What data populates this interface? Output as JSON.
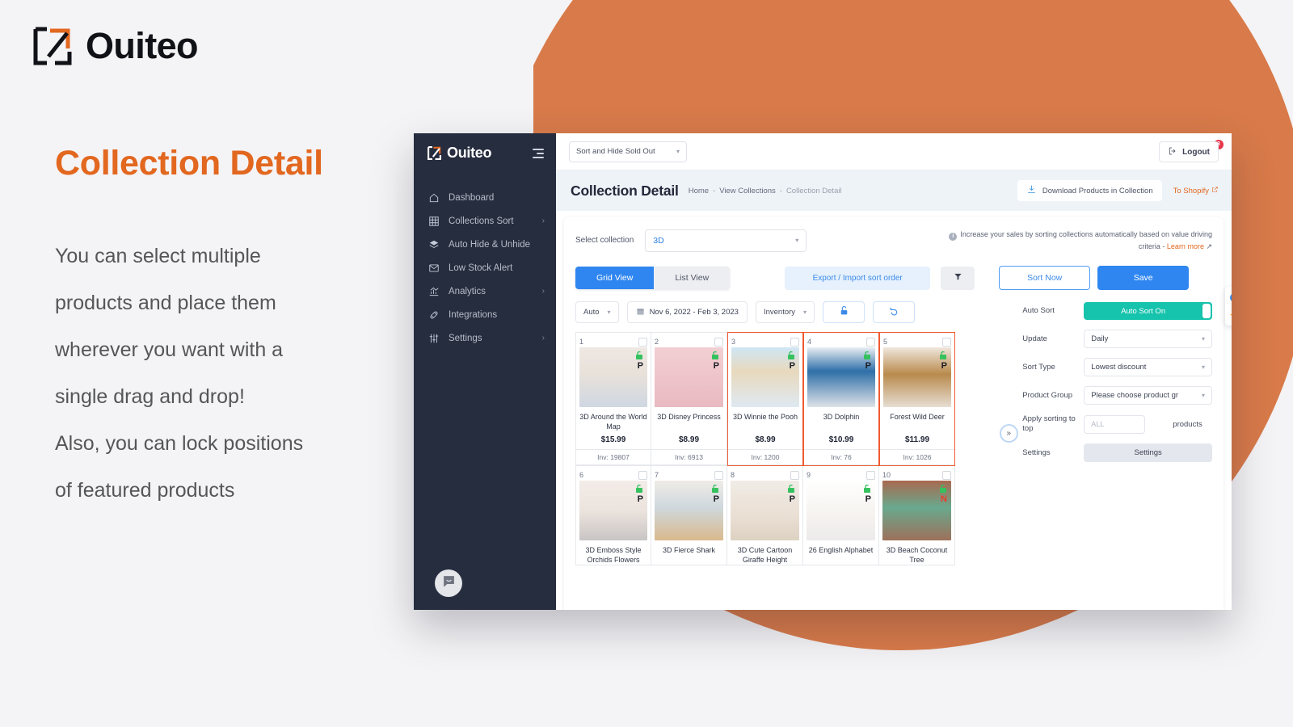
{
  "brand": {
    "name": "Ouiteo",
    "logo_icon": "ouiteo-square-arrow-logo"
  },
  "marketing": {
    "headline": "Collection Detail",
    "paragraphs": [
      "You can select multiple",
      "products and place them",
      "wherever you want with a",
      "single drag and drop!",
      "Also, you can lock positions",
      "of featured products"
    ],
    "accent_color": "#e2671f",
    "background_circle_color": "#d87a4a"
  },
  "sidebar": {
    "brand": "Ouiteo",
    "items": [
      {
        "label": "Dashboard",
        "icon": "home-icon",
        "caret": false
      },
      {
        "label": "Collections Sort",
        "icon": "grid-icon",
        "caret": true
      },
      {
        "label": "Auto Hide & Unhide",
        "icon": "layers-icon",
        "caret": false
      },
      {
        "label": "Low Stock Alert",
        "icon": "mail-icon",
        "caret": false
      },
      {
        "label": "Analytics",
        "icon": "chart-icon",
        "caret": true
      },
      {
        "label": "Integrations",
        "icon": "plug-icon",
        "caret": false
      },
      {
        "label": "Settings",
        "icon": "sliders-icon",
        "caret": true
      }
    ],
    "chat_icon": "chat-bubble-icon"
  },
  "topbar": {
    "mode_select": "Sort and Hide Sold Out",
    "flag_icon": "flag-icon",
    "bell_icon": "bell-icon",
    "notification_count": "3",
    "logout_label": "Logout",
    "logout_icon": "logout-icon"
  },
  "pagehead": {
    "title": "Collection Detail",
    "breadcrumb": [
      "Home",
      "View Collections",
      "Collection Detail"
    ],
    "separator": "-",
    "download_label": "Download Products in Collection",
    "download_icon": "download-icon",
    "shopify_label": "To Shopify",
    "shopify_icon": "external-link-icon"
  },
  "collection": {
    "select_label": "Select collection",
    "selected": "3D",
    "promo_text": "Increase your sales by sorting collections automatically based on value driving criteria -",
    "promo_link": "Learn more",
    "info_icon": "info-icon"
  },
  "toolbar": {
    "grid_view": "Grid View",
    "list_view": "List View",
    "export_import": "Export / Import sort order",
    "filter_icon": "funnel-icon",
    "sort_now": "Sort Now",
    "save": "Save"
  },
  "filters": {
    "mode": "Auto",
    "date_range": "Nov 6, 2022 - Feb 3, 2023",
    "calendar_icon": "calendar-icon",
    "metric": "Inventory",
    "lock_icon": "unlock-icon",
    "refresh_icon": "undo-icon"
  },
  "collapse_icon": "chevron-double-right-icon",
  "settings_panel": {
    "auto_sort": {
      "label": "Auto Sort",
      "value": "Auto Sort On",
      "color": "#16c3ac"
    },
    "update": {
      "label": "Update",
      "value": "Daily"
    },
    "sort_type": {
      "label": "Sort Type",
      "value": "Lowest discount"
    },
    "product_group": {
      "label": "Product Group",
      "value": "Please choose product gr"
    },
    "apply_sorting": {
      "label": "Apply sorting to top",
      "placeholder": "ALL",
      "suffix": "products"
    },
    "settings": {
      "label": "Settings",
      "button": "Settings"
    }
  },
  "side_tools": [
    {
      "name": "help-icon",
      "glyph": "?"
    },
    {
      "name": "star-icon",
      "glyph": "★"
    }
  ],
  "products": [
    {
      "num": "1",
      "name": "3D Around the World Map",
      "price": "$15.99",
      "inv": "Inv: 19807",
      "selected": false,
      "img": "im1",
      "lock": "unlocked",
      "flag": "P"
    },
    {
      "num": "2",
      "name": "3D Disney Princess",
      "price": "$8.99",
      "inv": "Inv: 6913",
      "selected": false,
      "img": "im2",
      "lock": "unlocked",
      "flag": "P"
    },
    {
      "num": "3",
      "name": "3D Winnie the Pooh",
      "price": "$8.99",
      "inv": "Inv: 1200",
      "selected": true,
      "img": "im3",
      "lock": "unlocked",
      "flag": "P"
    },
    {
      "num": "4",
      "name": "3D Dolphin",
      "price": "$10.99",
      "inv": "Inv: 76",
      "selected": true,
      "img": "im4",
      "lock": "unlocked",
      "flag": "P"
    },
    {
      "num": "5",
      "name": "Forest Wild Deer",
      "price": "$11.99",
      "inv": "Inv: 1026",
      "selected": true,
      "img": "im5",
      "lock": "unlocked",
      "flag": "P"
    },
    {
      "num": "6",
      "name": "3D Emboss Style Orchids Flowers",
      "price": "",
      "inv": "",
      "selected": false,
      "img": "im6",
      "lock": "unlocked",
      "flag": "P"
    },
    {
      "num": "7",
      "name": "3D Fierce Shark",
      "price": "",
      "inv": "",
      "selected": false,
      "img": "im7",
      "lock": "unlocked",
      "flag": "P"
    },
    {
      "num": "8",
      "name": "3D Cute Cartoon Giraffe Height",
      "price": "",
      "inv": "",
      "selected": false,
      "img": "im8",
      "lock": "unlocked",
      "flag": "P"
    },
    {
      "num": "9",
      "name": "26 English Alphabet",
      "price": "",
      "inv": "",
      "selected": false,
      "img": "im9",
      "lock": "unlocked",
      "flag": "P"
    },
    {
      "num": "10",
      "name": "3D Beach Coconut Tree",
      "price": "",
      "inv": "",
      "selected": false,
      "img": "im10",
      "lock": "unlocked",
      "flag": "N"
    }
  ]
}
